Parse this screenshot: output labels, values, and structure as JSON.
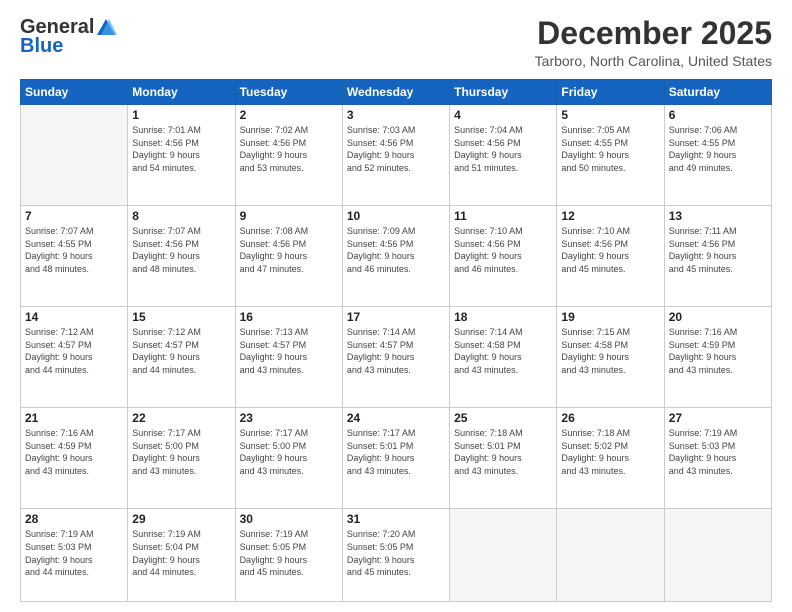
{
  "logo": {
    "general": "General",
    "blue": "Blue"
  },
  "header": {
    "title": "December 2025",
    "subtitle": "Tarboro, North Carolina, United States"
  },
  "days_of_week": [
    "Sunday",
    "Monday",
    "Tuesday",
    "Wednesday",
    "Thursday",
    "Friday",
    "Saturday"
  ],
  "weeks": [
    [
      {
        "day": "",
        "info": ""
      },
      {
        "day": "1",
        "info": "Sunrise: 7:01 AM\nSunset: 4:56 PM\nDaylight: 9 hours\nand 54 minutes."
      },
      {
        "day": "2",
        "info": "Sunrise: 7:02 AM\nSunset: 4:56 PM\nDaylight: 9 hours\nand 53 minutes."
      },
      {
        "day": "3",
        "info": "Sunrise: 7:03 AM\nSunset: 4:56 PM\nDaylight: 9 hours\nand 52 minutes."
      },
      {
        "day": "4",
        "info": "Sunrise: 7:04 AM\nSunset: 4:56 PM\nDaylight: 9 hours\nand 51 minutes."
      },
      {
        "day": "5",
        "info": "Sunrise: 7:05 AM\nSunset: 4:55 PM\nDaylight: 9 hours\nand 50 minutes."
      },
      {
        "day": "6",
        "info": "Sunrise: 7:06 AM\nSunset: 4:55 PM\nDaylight: 9 hours\nand 49 minutes."
      }
    ],
    [
      {
        "day": "7",
        "info": "Sunrise: 7:07 AM\nSunset: 4:55 PM\nDaylight: 9 hours\nand 48 minutes."
      },
      {
        "day": "8",
        "info": "Sunrise: 7:07 AM\nSunset: 4:56 PM\nDaylight: 9 hours\nand 48 minutes."
      },
      {
        "day": "9",
        "info": "Sunrise: 7:08 AM\nSunset: 4:56 PM\nDaylight: 9 hours\nand 47 minutes."
      },
      {
        "day": "10",
        "info": "Sunrise: 7:09 AM\nSunset: 4:56 PM\nDaylight: 9 hours\nand 46 minutes."
      },
      {
        "day": "11",
        "info": "Sunrise: 7:10 AM\nSunset: 4:56 PM\nDaylight: 9 hours\nand 46 minutes."
      },
      {
        "day": "12",
        "info": "Sunrise: 7:10 AM\nSunset: 4:56 PM\nDaylight: 9 hours\nand 45 minutes."
      },
      {
        "day": "13",
        "info": "Sunrise: 7:11 AM\nSunset: 4:56 PM\nDaylight: 9 hours\nand 45 minutes."
      }
    ],
    [
      {
        "day": "14",
        "info": "Sunrise: 7:12 AM\nSunset: 4:57 PM\nDaylight: 9 hours\nand 44 minutes."
      },
      {
        "day": "15",
        "info": "Sunrise: 7:12 AM\nSunset: 4:57 PM\nDaylight: 9 hours\nand 44 minutes."
      },
      {
        "day": "16",
        "info": "Sunrise: 7:13 AM\nSunset: 4:57 PM\nDaylight: 9 hours\nand 43 minutes."
      },
      {
        "day": "17",
        "info": "Sunrise: 7:14 AM\nSunset: 4:57 PM\nDaylight: 9 hours\nand 43 minutes."
      },
      {
        "day": "18",
        "info": "Sunrise: 7:14 AM\nSunset: 4:58 PM\nDaylight: 9 hours\nand 43 minutes."
      },
      {
        "day": "19",
        "info": "Sunrise: 7:15 AM\nSunset: 4:58 PM\nDaylight: 9 hours\nand 43 minutes."
      },
      {
        "day": "20",
        "info": "Sunrise: 7:16 AM\nSunset: 4:59 PM\nDaylight: 9 hours\nand 43 minutes."
      }
    ],
    [
      {
        "day": "21",
        "info": "Sunrise: 7:16 AM\nSunset: 4:59 PM\nDaylight: 9 hours\nand 43 minutes."
      },
      {
        "day": "22",
        "info": "Sunrise: 7:17 AM\nSunset: 5:00 PM\nDaylight: 9 hours\nand 43 minutes."
      },
      {
        "day": "23",
        "info": "Sunrise: 7:17 AM\nSunset: 5:00 PM\nDaylight: 9 hours\nand 43 minutes."
      },
      {
        "day": "24",
        "info": "Sunrise: 7:17 AM\nSunset: 5:01 PM\nDaylight: 9 hours\nand 43 minutes."
      },
      {
        "day": "25",
        "info": "Sunrise: 7:18 AM\nSunset: 5:01 PM\nDaylight: 9 hours\nand 43 minutes."
      },
      {
        "day": "26",
        "info": "Sunrise: 7:18 AM\nSunset: 5:02 PM\nDaylight: 9 hours\nand 43 minutes."
      },
      {
        "day": "27",
        "info": "Sunrise: 7:19 AM\nSunset: 5:03 PM\nDaylight: 9 hours\nand 43 minutes."
      }
    ],
    [
      {
        "day": "28",
        "info": "Sunrise: 7:19 AM\nSunset: 5:03 PM\nDaylight: 9 hours\nand 44 minutes."
      },
      {
        "day": "29",
        "info": "Sunrise: 7:19 AM\nSunset: 5:04 PM\nDaylight: 9 hours\nand 44 minutes."
      },
      {
        "day": "30",
        "info": "Sunrise: 7:19 AM\nSunset: 5:05 PM\nDaylight: 9 hours\nand 45 minutes."
      },
      {
        "day": "31",
        "info": "Sunrise: 7:20 AM\nSunset: 5:05 PM\nDaylight: 9 hours\nand 45 minutes."
      },
      {
        "day": "",
        "info": ""
      },
      {
        "day": "",
        "info": ""
      },
      {
        "day": "",
        "info": ""
      }
    ]
  ]
}
